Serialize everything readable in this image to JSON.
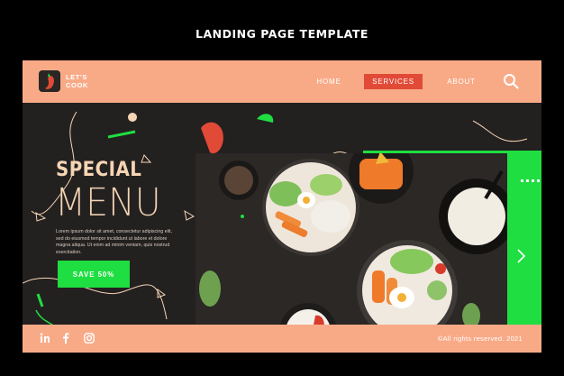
{
  "page": {
    "title": "LANDING PAGE TEMPLATE"
  },
  "header": {
    "logo_text": "LET'S COOK",
    "nav": {
      "home": "HOME",
      "services": "SERVICES",
      "about": "ABOUT"
    },
    "search_icon": "search-icon"
  },
  "hero": {
    "headline_top": "SPECIAL",
    "headline_bottom": "MENU",
    "description": "Lorem ipsum dolor sit amet, consectetur adipiscing elit, sed do eiusmod tempor incididunt ut labore et dolore magna aliqua. Ut enim ad minim veniam, quis nostrud exercitation.",
    "cta_label": "SAVE 50%"
  },
  "footer": {
    "social": [
      "linkedin-icon",
      "facebook-icon",
      "instagram-icon"
    ],
    "copyright": "©All rights reserved. 2021"
  },
  "colors": {
    "peach": "#f8aa87",
    "accent_red": "#e14a37",
    "green": "#1fde41",
    "dark": "#232020",
    "cream": "#f5d5b4"
  }
}
